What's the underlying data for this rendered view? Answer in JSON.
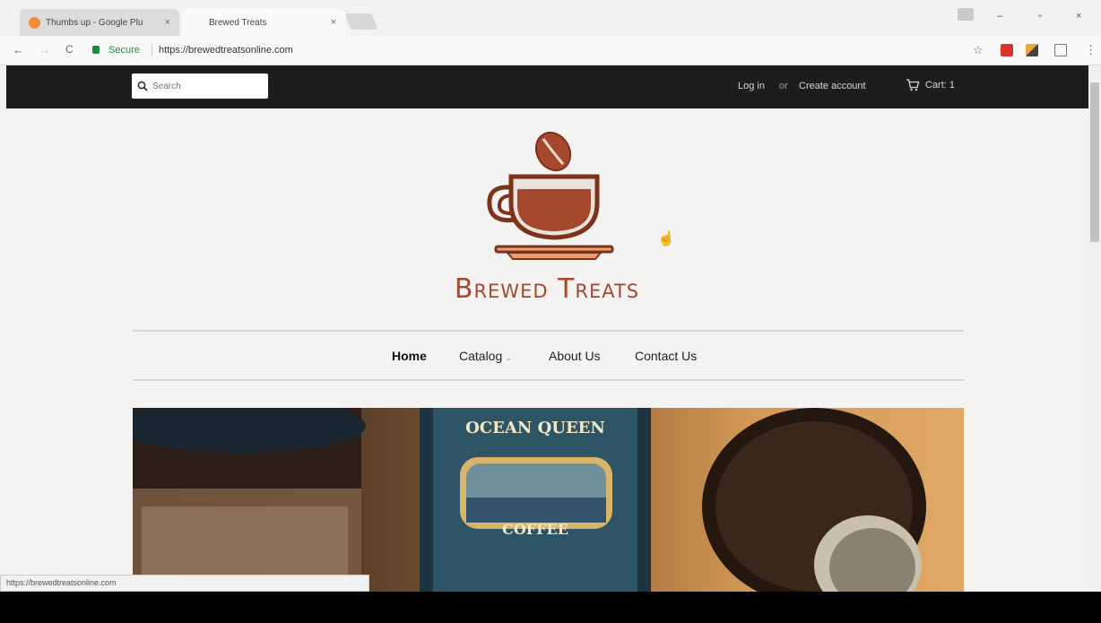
{
  "browser": {
    "tabs": [
      {
        "title": "Thumbs up - Google Plu",
        "close": "×"
      },
      {
        "title": "Brewed Treats",
        "close": "×"
      }
    ],
    "nav": {
      "back": "←",
      "forward": "→",
      "reload": "C"
    },
    "security_label": "Secure",
    "url": "https://brewedtreatsonline.com",
    "star": "☆",
    "menu": "⋮",
    "window": {
      "minimize": "–",
      "restore": "▫",
      "close": "×"
    },
    "status_url": "https://brewedtreatsonline.com"
  },
  "site": {
    "search_placeholder": "Search",
    "login": "Log in",
    "or": "or",
    "create_account": "Create account",
    "cart": "Cart: 1",
    "brand": "Brewed Treats",
    "menu": [
      {
        "label": "Home"
      },
      {
        "label": "Catalog"
      },
      {
        "label": "About Us"
      },
      {
        "label": "Contact Us"
      }
    ],
    "catalog_caret": "⌄",
    "hero_text": {
      "line1": "OCEAN QUEEN",
      "line2": "COFFEE"
    },
    "accent_color": "#a4492e"
  }
}
